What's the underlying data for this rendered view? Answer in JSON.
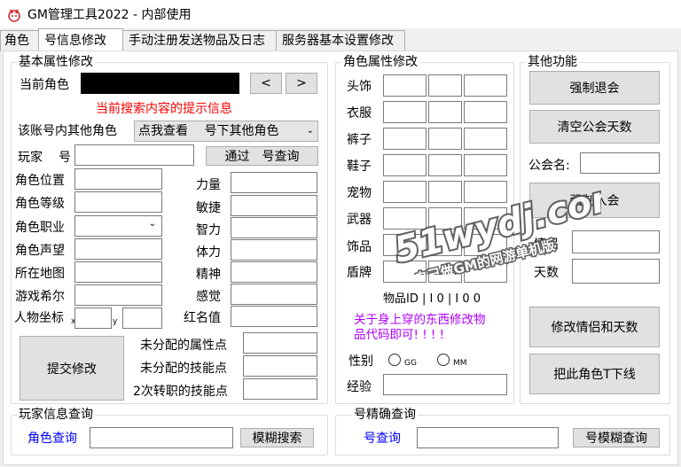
{
  "window": {
    "title": "GM管理工具2022 - 内部使用"
  },
  "tabs": [
    "角色",
    "号信息修改",
    "手动注册发送物品及日志",
    "服务器基本设置修改"
  ],
  "basic": {
    "legend": "基本属性修改",
    "current_role_label": "当前角色",
    "prev_btn": "<",
    "next_btn": ">",
    "hint": "当前搜索内容的提示信息",
    "other_roles_label": "该账号内其他角色",
    "other_roles_btn": "点我查看",
    "other_roles_select": "号下其他角色",
    "player_label": "玩家",
    "player_label2": "号",
    "query_btn": "通过",
    "query_btn2": "号查询",
    "left_fields": [
      "角色位置",
      "角色等级",
      "角色职业",
      "角色声望",
      "所在地图",
      "游戏希尔"
    ],
    "coord_label": "人物坐标",
    "coord_x": "x",
    "coord_y": "y",
    "right_fields": [
      "力量",
      "敏捷",
      "智力",
      "体力",
      "精神",
      "感觉",
      "红名值"
    ],
    "submit_btn": "提交修改",
    "points": [
      "未分配的属性点",
      "未分配的技能点",
      "2次转职的技能点"
    ]
  },
  "role_attr": {
    "legend": "角色属性修改",
    "slots": [
      "头饰",
      "衣服",
      "裤子",
      "鞋子",
      "宠物",
      "武器",
      "饰品",
      "盾牌"
    ],
    "item_id_label": "物品ID | I 0 | I 0 0",
    "note_line1": "关于身上穿的东西修改物",
    "note_line2": "品代码即可! ! ! !",
    "gender_label": "性别",
    "gender_gg": "GG",
    "gender_mm": "MM",
    "exp_label": "经验"
  },
  "other": {
    "legend": "其他功能",
    "force_logout": "强制退会",
    "clear_guild_days": "清空公会天数",
    "guild_name_label": "公会名:",
    "force_join": "强制入会",
    "partner_label": "情侣",
    "days_label": "天数",
    "modify_partner": "修改情侣和天数",
    "kick_offline": "把此角色T下线"
  },
  "player_query": {
    "legend": "玩家信息查询",
    "role_query_label": "角色查询",
    "fuzzy_btn": "模糊搜索"
  },
  "exact_query": {
    "legend": "号精确查询",
    "account_query_label": "号查询",
    "fuzzy_btn": "号模糊查询"
  },
  "watermark": {
    "line1": "51wydj.com",
    "line2": "自己做GM的网游单机版"
  }
}
